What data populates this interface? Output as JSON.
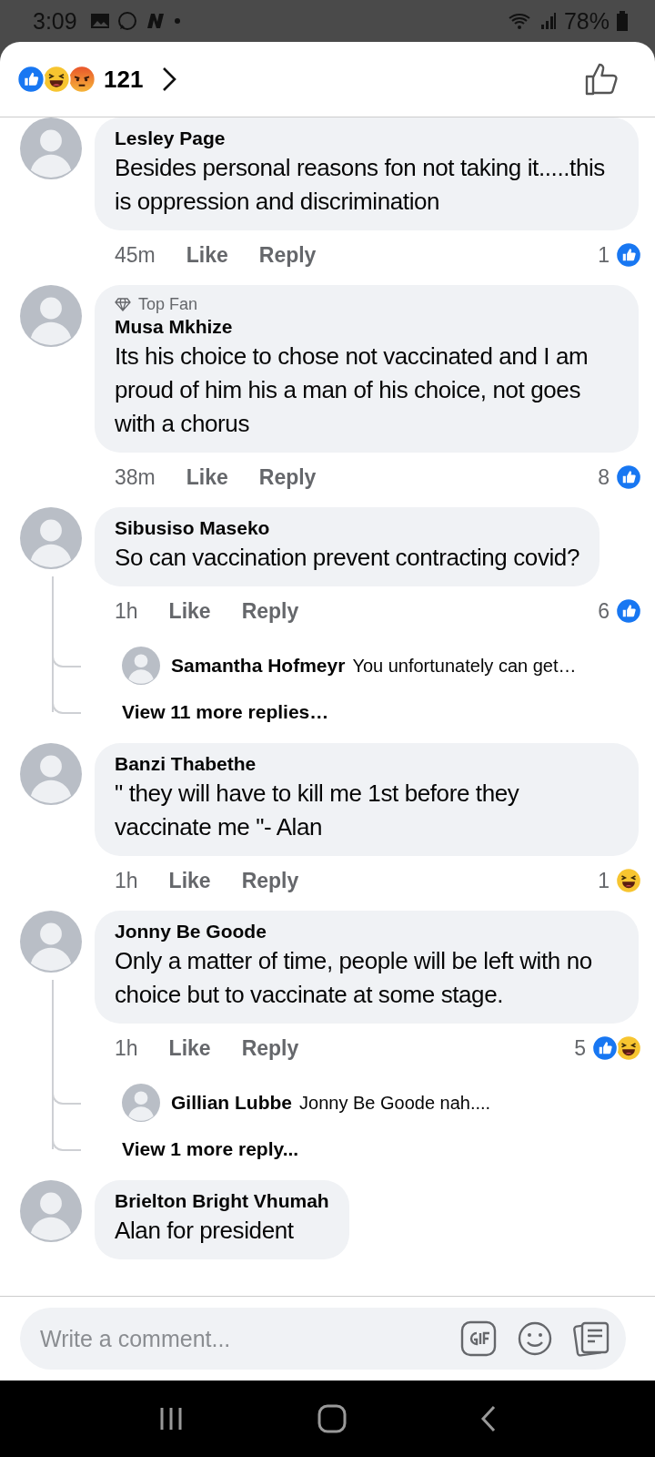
{
  "status_bar": {
    "time": "3:09",
    "battery": "78%"
  },
  "header": {
    "reactions": [
      {
        "kind": "like"
      },
      {
        "kind": "haha"
      },
      {
        "kind": "angry"
      }
    ],
    "count": "121"
  },
  "comments": [
    {
      "author": "Lesley Page",
      "text": "Besides personal reasons fon not taking it.....this is oppression and discrimination",
      "time": "45m",
      "like": "Like",
      "reply": "Reply",
      "reaction_count": "1",
      "reactions": [
        {
          "kind": "like"
        }
      ]
    },
    {
      "author": "Musa Mkhize",
      "badge": "Top Fan",
      "text": "Its his choice to chose not vaccinated and I am proud of him his a man of his choice, not goes with a chorus",
      "time": "38m",
      "like": "Like",
      "reply": "Reply",
      "reaction_count": "8",
      "reactions": [
        {
          "kind": "like"
        }
      ]
    },
    {
      "author": "Sibusiso Maseko",
      "text": "So can vaccination prevent contracting covid?",
      "time": "1h",
      "like": "Like",
      "reply": "Reply",
      "reaction_count": "6",
      "reactions": [
        {
          "kind": "like"
        }
      ],
      "replies": [
        {
          "author": "Samantha Hofmeyr",
          "text": "You unfortunately can get…"
        }
      ],
      "more_replies": "View 11 more replies…"
    },
    {
      "author": "Banzi Thabethe",
      "text": "\" they will have to kill me 1st before they vaccinate me \"- Alan",
      "time": "1h",
      "like": "Like",
      "reply": "Reply",
      "reaction_count": "1",
      "reactions": [
        {
          "kind": "haha"
        }
      ]
    },
    {
      "author": "Jonny Be Goode",
      "text": "Only a matter of time, people will be left with no choice but to vaccinate at some stage.",
      "time": "1h",
      "like": "Like",
      "reply": "Reply",
      "reaction_count": "5",
      "reactions": [
        {
          "kind": "like"
        },
        {
          "kind": "haha"
        }
      ],
      "replies": [
        {
          "author": "Gillian Lubbe",
          "text": "Jonny Be Goode nah...."
        }
      ],
      "more_replies": "View 1 more reply..."
    },
    {
      "author": "Brielton Bright Vhumah",
      "text": "Alan for president"
    }
  ],
  "composer": {
    "placeholder": "Write a comment..."
  }
}
